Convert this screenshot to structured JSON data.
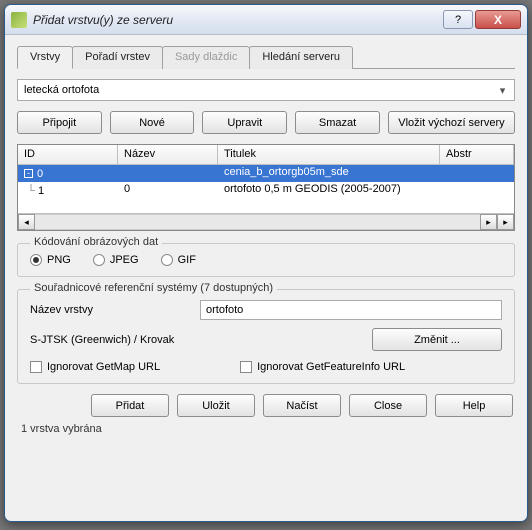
{
  "window": {
    "title": "Přidat vrstvu(y) ze serveru"
  },
  "tabs": {
    "layers": "Vrstvy",
    "order": "Pořadí vrstev",
    "tilesets": "Sady dlaždic",
    "search": "Hledání serveru"
  },
  "connection": {
    "selected": "letecká ortofota",
    "connect": "Připojit",
    "new": "Nové",
    "edit": "Upravit",
    "delete": "Smazat",
    "default": "Vložit výchozí servery"
  },
  "table": {
    "headers": {
      "id": "ID",
      "name": "Název",
      "title": "Titulek",
      "abstract": "Abstr"
    },
    "rows": [
      {
        "id": "0",
        "name": "",
        "title": "cenia_b_ortorgb05m_sde"
      },
      {
        "id": "1",
        "name": "0",
        "title": "ortofoto 0,5 m GEODIS (2005-2007)"
      }
    ]
  },
  "encoding": {
    "group": "Kódování obrázových dat",
    "png": "PNG",
    "jpeg": "JPEG",
    "gif": "GIF"
  },
  "crs": {
    "group": "Souřadnicové referenční systémy  (7 dostupných)",
    "layerNameLabel": "Název vrstvy",
    "layerNameValue": "ortofoto",
    "crsName": "S-JTSK (Greenwich) / Krovak",
    "change": "Změnit ...",
    "ignoreGetMap": "Ignorovat GetMap URL",
    "ignoreGetFeatureInfo": "Ignorovat GetFeatureInfo URL"
  },
  "footer": {
    "add": "Přidat",
    "save": "Uložit",
    "load": "Načíst",
    "close": "Close",
    "help": "Help"
  },
  "status": "1 vrstva vybrána"
}
